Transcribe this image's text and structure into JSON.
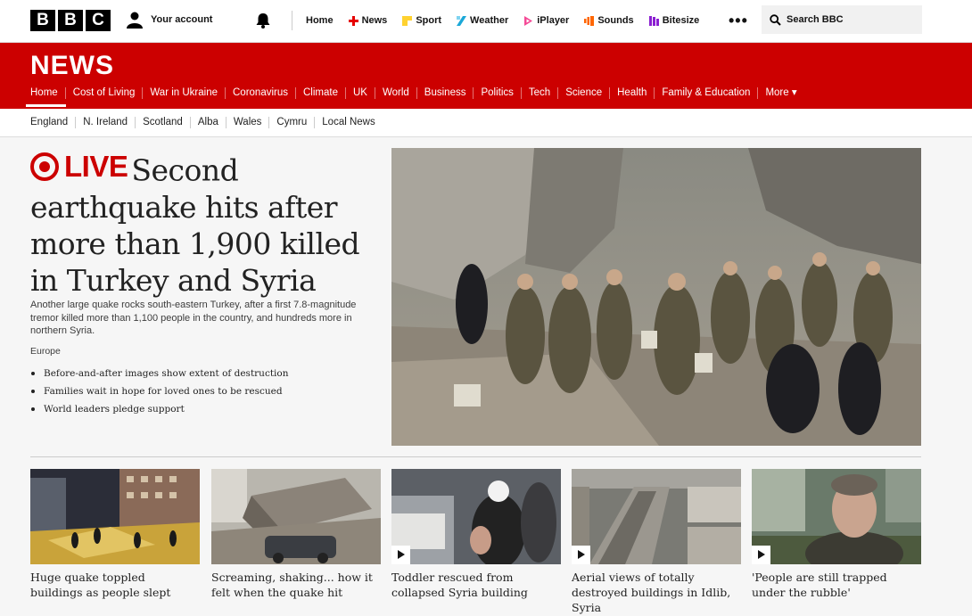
{
  "topbar": {
    "logo_letters": [
      "B",
      "B",
      "C"
    ],
    "account_label": "Your account",
    "nav": [
      {
        "label": "Home",
        "icon": "",
        "color": ""
      },
      {
        "label": "News",
        "icon": "news-icon",
        "color": "#e60000"
      },
      {
        "label": "Sport",
        "icon": "sport-icon",
        "color": "#ffd230"
      },
      {
        "label": "Weather",
        "icon": "weather-icon",
        "color": "#1ba8d8"
      },
      {
        "label": "iPlayer",
        "icon": "iplayer-icon",
        "color": "#f54996"
      },
      {
        "label": "Sounds",
        "icon": "sounds-icon",
        "color": "#ff6600"
      },
      {
        "label": "Bitesize",
        "icon": "bitesize-icon",
        "color": "#8b1fd1"
      }
    ],
    "more_label": "•••",
    "search_placeholder": "Search BBC"
  },
  "newsbar": {
    "title": "NEWS",
    "nav": [
      "Home",
      "Cost of Living",
      "War in Ukraine",
      "Coronavirus",
      "Climate",
      "UK",
      "World",
      "Business",
      "Politics",
      "Tech",
      "Science",
      "Health",
      "Family & Education",
      "More ▾"
    ],
    "active": "Home"
  },
  "subnav": [
    "England",
    "N. Ireland",
    "Scotland",
    "Alba",
    "Wales",
    "Cymru",
    "Local News"
  ],
  "lead": {
    "live_label": "LIVE",
    "headline": "Second earthquake hits after more than 1,900 killed in Turkey and Syria",
    "summary": "Another large quake rocks south-eastern Turkey, after a first 7.8-magnitude tremor killed more than 1,100 people in the country, and hundreds more in northern Syria.",
    "tag": "Europe",
    "bullets": [
      "Before-and-after images show extent of destruction",
      "Families wait in hope for loved ones to be rescued",
      "World leaders pledge support"
    ]
  },
  "cards": [
    {
      "title": "Huge quake toppled buildings as people slept",
      "video": false
    },
    {
      "title": "Screaming, shaking... how it felt when the quake hit",
      "video": false
    },
    {
      "title": "Toddler rescued from collapsed Syria building",
      "video": true
    },
    {
      "title": "Aerial views of totally destroyed buildings in Idlib, Syria",
      "video": true
    },
    {
      "title": "'People are still trapped under the rubble'",
      "video": true
    }
  ],
  "colors": {
    "brand_red": "#cc0000",
    "black": "#000000"
  }
}
